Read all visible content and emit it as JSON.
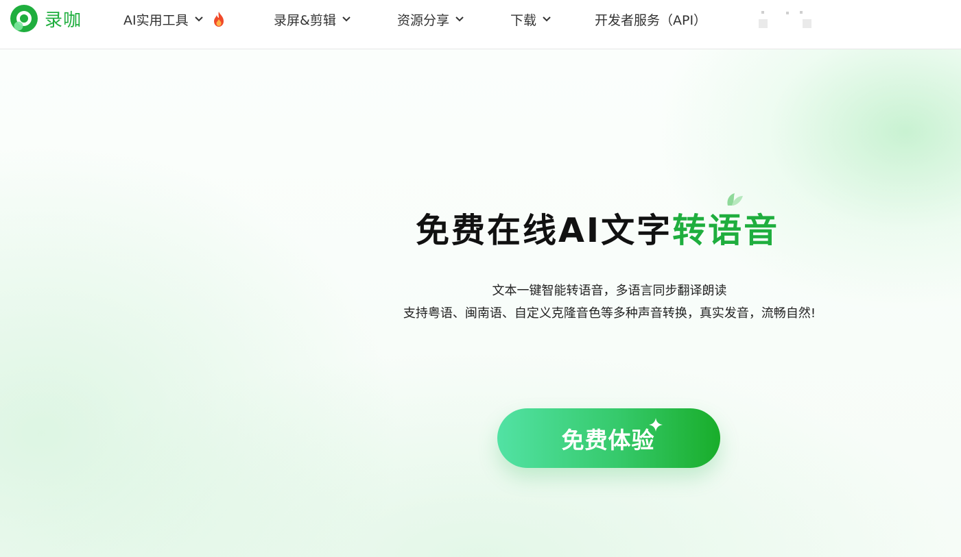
{
  "header": {
    "logo_text": "录咖",
    "nav": [
      {
        "label": "AI实用工具",
        "has_dropdown": true,
        "badge_icon": "fire-icon"
      },
      {
        "label": "录屏&剪辑",
        "has_dropdown": true
      },
      {
        "label": "资源分享",
        "has_dropdown": true
      },
      {
        "label": "下载",
        "has_dropdown": true
      },
      {
        "label": "开发者服务（API）",
        "has_dropdown": false
      }
    ]
  },
  "hero": {
    "title_main": "免费在线AI文字",
    "title_accent": "转语音",
    "subtitle_line1": "文本一键智能转语音，多语言同步翻译朗读",
    "subtitle_line2": "支持粤语、闽南语、自定义克隆音色等多种声音转换，真实发音，流畅自然!",
    "cta_label": "免费体验"
  },
  "colors": {
    "brand_green": "#1fae3e",
    "cta_gradient_start": "#52e2a4",
    "cta_gradient_end": "#19ad2a",
    "fire": "#f04a2a"
  }
}
